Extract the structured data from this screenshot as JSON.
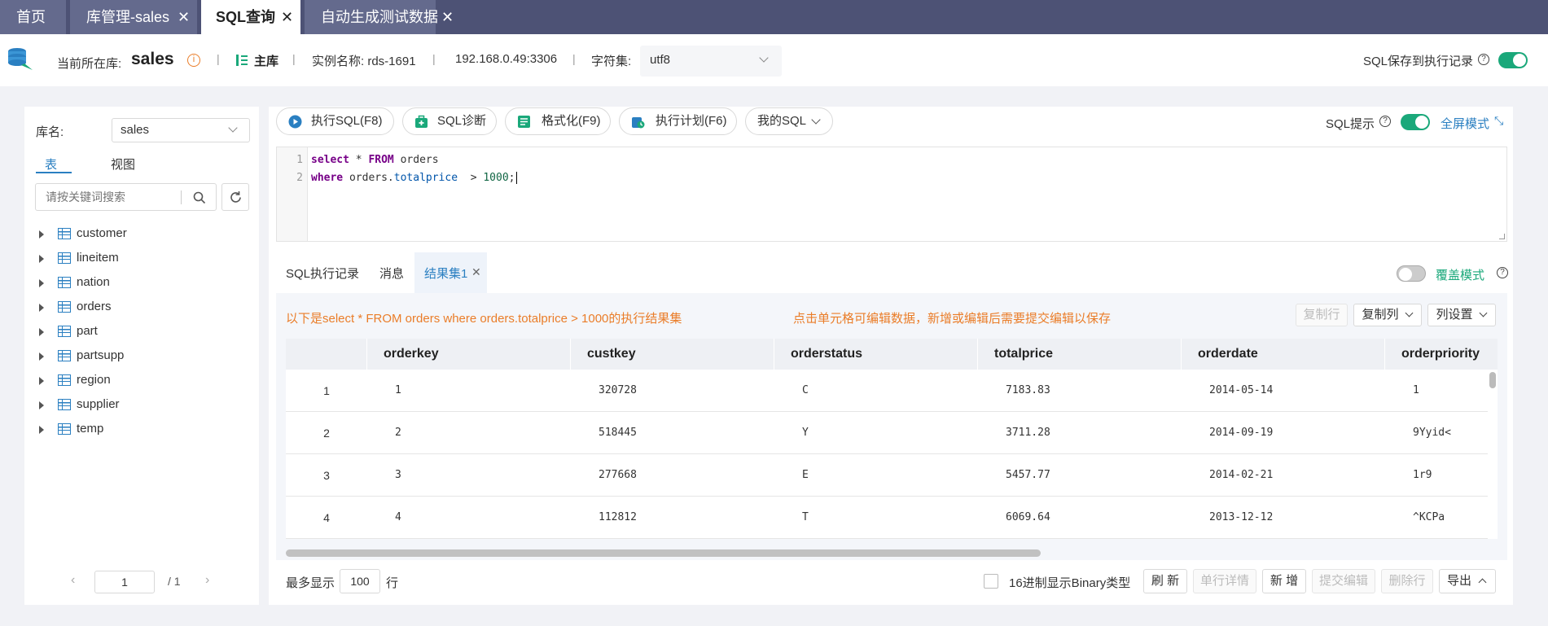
{
  "tabs": [
    {
      "label": "首页"
    },
    {
      "label": "库管理-sales"
    },
    {
      "label": "SQL查询"
    },
    {
      "label": "自动生成测试数据"
    }
  ],
  "info": {
    "db_label": "当前所在库:",
    "db_name": "sales",
    "role": "主库",
    "instance": "实例名称:  rds-1691",
    "address": "192.168.0.49:3306",
    "charset_label": "字符集:",
    "charset": "utf8",
    "save_label": "SQL保存到执行记录"
  },
  "sidebar": {
    "db_label": "库名:",
    "db_value": "sales",
    "tab_table": "表",
    "tab_view": "视图",
    "search_placeholder": "请按关键词搜索",
    "tables": [
      "customer",
      "lineitem",
      "nation",
      "orders",
      "part",
      "partsupp",
      "region",
      "supplier",
      "temp"
    ],
    "page": "1",
    "page_total": "/ 1"
  },
  "toolbar": {
    "run": "执行SQL(F8)",
    "diagnose": "SQL诊断",
    "format": "格式化(F9)",
    "plan": "执行计划(F6)",
    "mysql": "我的SQL",
    "hint": "SQL提示",
    "fullscreen": "全屏模式"
  },
  "editor": {
    "line1_no": "1",
    "line2_no": "2",
    "l1_kw1": "select",
    "l1_mid": " * ",
    "l1_kw2": "FROM",
    "l1_tail": " orders",
    "l2_kw": "where",
    "l2_a": " orders.",
    "l2_field": "totalprice",
    "l2_op": "  > ",
    "l2_num": "1000",
    "l2_end": ";"
  },
  "result_tabs": {
    "history": "SQL执行记录",
    "messages": "消息",
    "resultset": "结果集1",
    "overwrite": "覆盖模式"
  },
  "result": {
    "summary": "以下是select * FROM orders where orders.totalprice > 1000的执行结果集",
    "edit_hint": "点击单元格可编辑数据，新增或编辑后需要提交编辑以保存",
    "copy_row": "复制行",
    "copy_col": "复制列",
    "col_settings": "列设置",
    "columns": [
      "orderkey",
      "custkey",
      "orderstatus",
      "totalprice",
      "orderdate",
      "orderpriority"
    ],
    "rows": [
      {
        "n": "1",
        "cells": [
          "1",
          "320728",
          "C",
          "7183.83",
          "2014-05-14",
          "1"
        ]
      },
      {
        "n": "2",
        "cells": [
          "2",
          "518445",
          "Y",
          "3711.28",
          "2014-09-19",
          "9Yyid<"
        ]
      },
      {
        "n": "3",
        "cells": [
          "3",
          "277668",
          "E",
          "5457.77",
          "2014-02-21",
          "1r9"
        ]
      },
      {
        "n": "4",
        "cells": [
          "4",
          "112812",
          "T",
          "6069.64",
          "2013-12-12",
          "^KCPa"
        ]
      }
    ]
  },
  "footer": {
    "max_label": "最多显示",
    "max_value": "100",
    "row_unit": "行",
    "binary": "16进制显示Binary类型",
    "refresh": "刷 新",
    "detail": "单行详情",
    "add": "新 增",
    "submit": "提交编辑",
    "delete": "删除行",
    "export": "导出"
  },
  "colors": {
    "accent": "#1aa87a",
    "link": "#2a7fc1",
    "orange": "#ea7d29",
    "tabbar": "#4d5275"
  }
}
